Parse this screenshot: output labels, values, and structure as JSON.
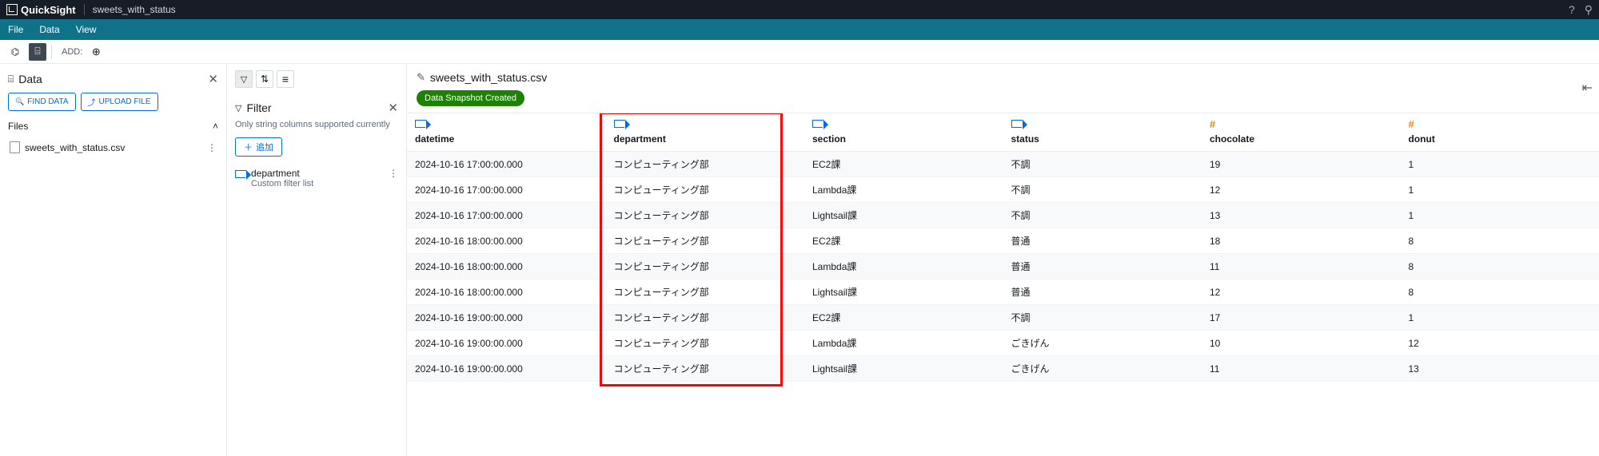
{
  "topbar": {
    "brand": "QuickSight",
    "title": "sweets_with_status"
  },
  "menu": {
    "file": "File",
    "data": "Data",
    "view": "View"
  },
  "toolbar": {
    "add_label": "ADD:"
  },
  "left": {
    "title": "Data",
    "find_btn": "FIND DATA",
    "upload_btn": "UPLOAD FILE",
    "files_label": "Files",
    "files": [
      {
        "name": "sweets_with_status.csv"
      }
    ]
  },
  "filter": {
    "title": "Filter",
    "hint": "Only string columns supported currently",
    "add_label": "追加",
    "item": {
      "name": "department",
      "sub": "Custom filter list"
    }
  },
  "content": {
    "title": "sweets_with_status.csv",
    "badge": "Data Snapshot Created"
  },
  "highlight_column": "department",
  "columns": [
    {
      "name": "datetime",
      "type": "tag"
    },
    {
      "name": "department",
      "type": "tag"
    },
    {
      "name": "section",
      "type": "tag"
    },
    {
      "name": "status",
      "type": "tag"
    },
    {
      "name": "chocolate",
      "type": "num"
    },
    {
      "name": "donut",
      "type": "num"
    }
  ],
  "rows": [
    {
      "datetime": "2024-10-16 17:00:00.000",
      "department": "コンピューティング部",
      "section": "EC2課",
      "status": "不調",
      "chocolate": "19",
      "donut": "1"
    },
    {
      "datetime": "2024-10-16 17:00:00.000",
      "department": "コンピューティング部",
      "section": "Lambda課",
      "status": "不調",
      "chocolate": "12",
      "donut": "1"
    },
    {
      "datetime": "2024-10-16 17:00:00.000",
      "department": "コンピューティング部",
      "section": "Lightsail課",
      "status": "不調",
      "chocolate": "13",
      "donut": "1"
    },
    {
      "datetime": "2024-10-16 18:00:00.000",
      "department": "コンピューティング部",
      "section": "EC2課",
      "status": "普通",
      "chocolate": "18",
      "donut": "8"
    },
    {
      "datetime": "2024-10-16 18:00:00.000",
      "department": "コンピューティング部",
      "section": "Lambda課",
      "status": "普通",
      "chocolate": "11",
      "donut": "8"
    },
    {
      "datetime": "2024-10-16 18:00:00.000",
      "department": "コンピューティング部",
      "section": "Lightsail課",
      "status": "普通",
      "chocolate": "12",
      "donut": "8"
    },
    {
      "datetime": "2024-10-16 19:00:00.000",
      "department": "コンピューティング部",
      "section": "EC2課",
      "status": "不調",
      "chocolate": "17",
      "donut": "1"
    },
    {
      "datetime": "2024-10-16 19:00:00.000",
      "department": "コンピューティング部",
      "section": "Lambda課",
      "status": "ごきげん",
      "chocolate": "10",
      "donut": "12"
    },
    {
      "datetime": "2024-10-16 19:00:00.000",
      "department": "コンピューティング部",
      "section": "Lightsail課",
      "status": "ごきげん",
      "chocolate": "11",
      "donut": "13"
    }
  ]
}
